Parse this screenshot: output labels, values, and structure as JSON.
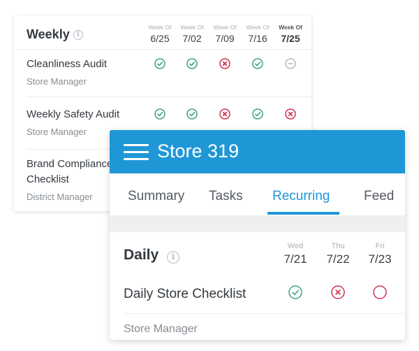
{
  "weekly": {
    "title": "Weekly",
    "info_icon": "info-icon",
    "columns": [
      {
        "label": "Week Of",
        "date": "6/25",
        "current": false
      },
      {
        "label": "Week Of",
        "date": "7/02",
        "current": false
      },
      {
        "label": "Week Of",
        "date": "7/09",
        "current": false
      },
      {
        "label": "Week Of",
        "date": "7/16",
        "current": false
      },
      {
        "label": "Week Of",
        "date": "7/25",
        "current": true
      }
    ],
    "tasks": [
      {
        "name": "Cleanliness Audit",
        "role": "Store Manager",
        "statuses": [
          "done",
          "done",
          "missed",
          "done",
          "na"
        ]
      },
      {
        "name": "Weekly Safety Audit",
        "role": "Store Manager",
        "statuses": [
          "done",
          "done",
          "missed",
          "done",
          "missed"
        ]
      },
      {
        "name": "Brand Compliance Checklist",
        "role": "District Manager",
        "statuses": []
      }
    ]
  },
  "store": {
    "menu_icon": "hamburger-menu-icon",
    "title": "Store 319",
    "tabs": [
      {
        "label": "Summary",
        "active": false
      },
      {
        "label": "Tasks",
        "active": false
      },
      {
        "label": "Recurring",
        "active": true
      },
      {
        "label": "Feed",
        "active": false
      }
    ],
    "daily": {
      "title": "Daily",
      "info_icon": "info-icon",
      "columns": [
        {
          "day": "Wed",
          "date": "7/21"
        },
        {
          "day": "Thu",
          "date": "7/22"
        },
        {
          "day": "Fri",
          "date": "7/23"
        }
      ],
      "tasks": [
        {
          "name": "Daily Store Checklist",
          "role": "Store Manager",
          "statuses": [
            "done",
            "missed",
            "pending"
          ]
        }
      ]
    }
  },
  "colors": {
    "brand_blue": "#1f97d6",
    "done_green": "#3aa57a",
    "missed_red": "#d0344e",
    "na_grey": "#b5b9bd"
  }
}
